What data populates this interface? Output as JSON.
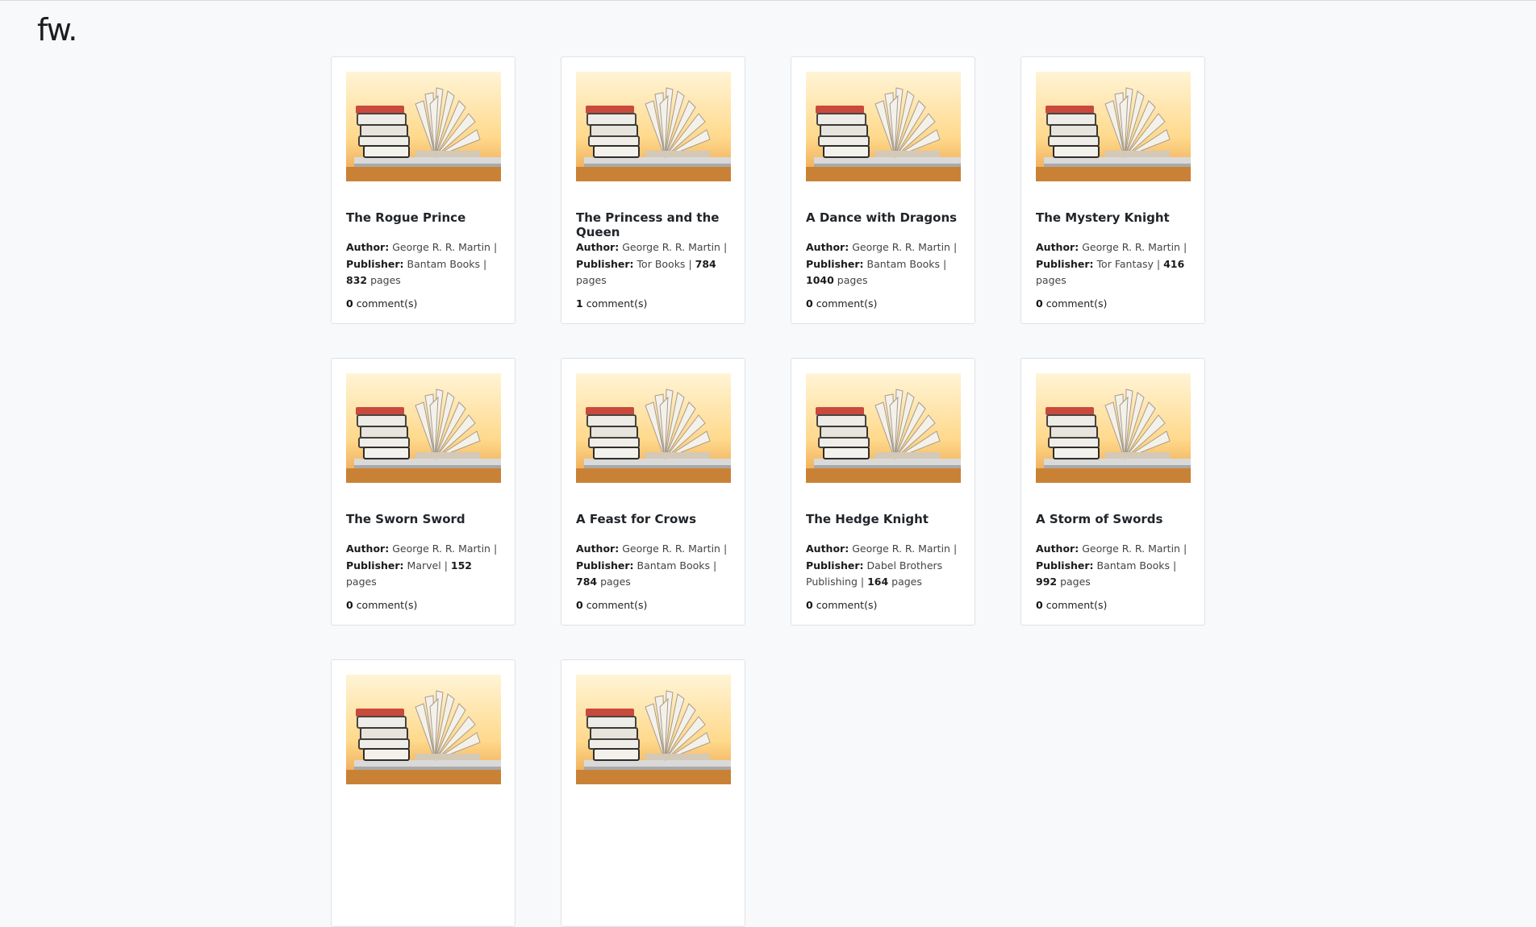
{
  "brand": {
    "logo_text": "fw."
  },
  "labels": {
    "author": "Author:",
    "publisher": "Publisher:",
    "pages": "pages",
    "comments": "comment(s)",
    "sep": "|"
  },
  "books": [
    {
      "title": "The Rogue Prince",
      "author": "George R. R. Martin",
      "publisher": "Bantam Books",
      "pages": "832",
      "comments": "0"
    },
    {
      "title": "The Princess and the Queen",
      "author": "George R. R. Martin",
      "publisher": "Tor Books",
      "pages": "784",
      "comments": "1"
    },
    {
      "title": "A Dance with Dragons",
      "author": "George R. R. Martin",
      "publisher": "Bantam Books",
      "pages": "1040",
      "comments": "0"
    },
    {
      "title": "The Mystery Knight",
      "author": "George R. R. Martin",
      "publisher": "Tor Fantasy",
      "pages": "416",
      "comments": "0"
    },
    {
      "title": "The Sworn Sword",
      "author": "George R. R. Martin",
      "publisher": "Marvel",
      "pages": "152",
      "comments": "0"
    },
    {
      "title": "A Feast for Crows",
      "author": "George R. R. Martin",
      "publisher": "Bantam Books",
      "pages": "784",
      "comments": "0"
    },
    {
      "title": "The Hedge Knight",
      "author": "George R. R. Martin",
      "publisher": "Dabel Brothers Publishing",
      "pages": "164",
      "comments": "0"
    },
    {
      "title": "A Storm of Swords",
      "author": "George R. R. Martin",
      "publisher": "Bantam Books",
      "pages": "992",
      "comments": "0"
    },
    {
      "title": "",
      "author": "",
      "publisher": "",
      "pages": "",
      "comments": ""
    },
    {
      "title": "",
      "author": "",
      "publisher": "",
      "pages": "",
      "comments": ""
    }
  ]
}
